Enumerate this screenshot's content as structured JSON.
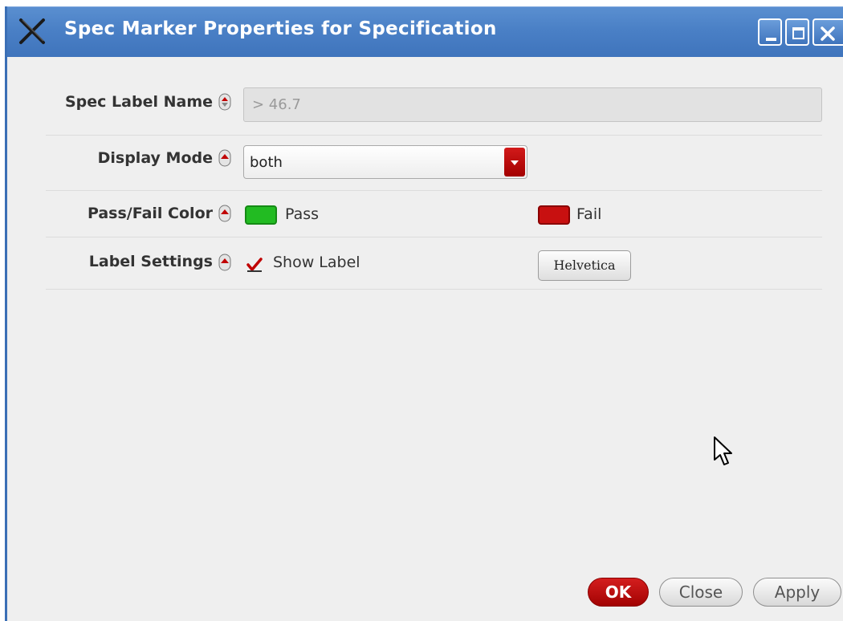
{
  "window": {
    "title": "Spec Marker Properties for Specification",
    "controls": [
      "minimize",
      "maximize",
      "close"
    ]
  },
  "form": {
    "spec_label_name": {
      "label": "Spec Label Name",
      "value": "> 46.7"
    },
    "display_mode": {
      "label": "Display Mode",
      "selected": "both"
    },
    "pass_fail_color": {
      "label": "Pass/Fail Color",
      "pass_label": "Pass",
      "pass_color": "#22bb22",
      "fail_label": "Fail",
      "fail_color": "#c81010"
    },
    "label_settings": {
      "label": "Label Settings",
      "show_label_text": "Show Label",
      "show_label_checked": true,
      "font_button": "Helvetica"
    }
  },
  "buttons": {
    "ok": "OK",
    "close": "Close",
    "apply": "Apply"
  },
  "colors": {
    "title_bar": "#4a80c6",
    "accent_red": "#c00000",
    "background": "#efefef"
  },
  "icons": [
    "app-x-icon",
    "minimize-icon",
    "maximize-icon",
    "close-icon",
    "spinner-icon",
    "dropdown-arrow-icon",
    "checkmark-icon",
    "mouse-cursor-icon"
  ]
}
